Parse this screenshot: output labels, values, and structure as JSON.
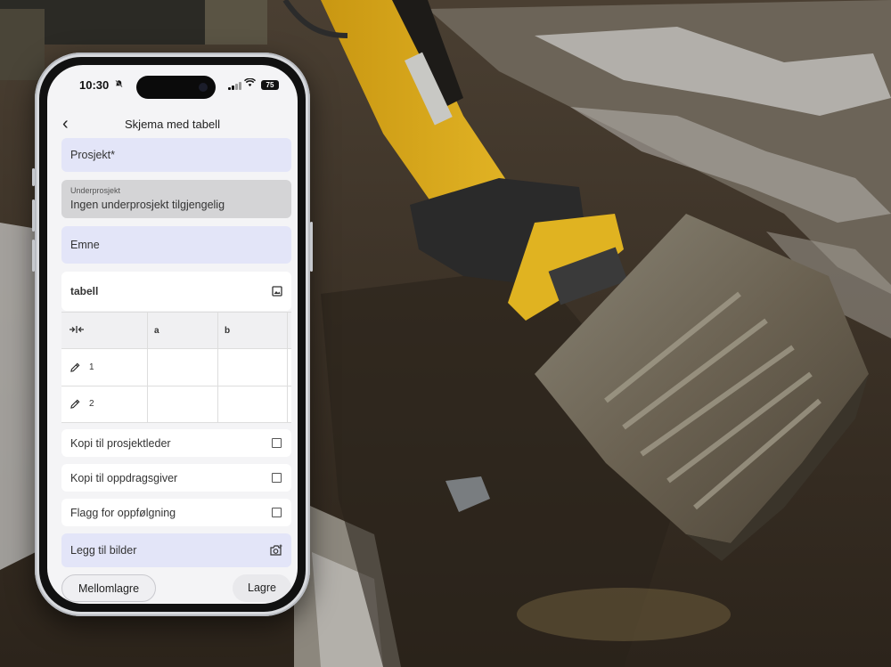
{
  "status_bar": {
    "time": "10:30",
    "battery": "75"
  },
  "nav": {
    "back_glyph": "‹",
    "title": "Skjema med tabell"
  },
  "form": {
    "prosjekt_label": "Prosjekt*",
    "underprosjekt_label": "Underprosjekt",
    "underprosjekt_value": "Ingen underprosjekt tilgjengelig",
    "emne_label": "Emne",
    "table_title": "tabell",
    "table": {
      "columns": [
        "",
        "a",
        "b"
      ],
      "rows": [
        {
          "label": "1"
        },
        {
          "label": "2"
        }
      ]
    },
    "checkboxes": [
      {
        "label": "Kopi til prosjektleder",
        "checked": false
      },
      {
        "label": "Kopi til oppdragsgiver",
        "checked": false
      },
      {
        "label": "Flagg for oppfølgning",
        "checked": false
      }
    ],
    "add_images_label": "Legg til bilder"
  },
  "buttons": {
    "draft_label": "Mellomlagre",
    "save_label": "Lagre"
  },
  "icons": {
    "back": "chevron-left-icon",
    "image": "image-icon",
    "collapse": "collapse-columns-icon",
    "edit": "pencil-icon",
    "camera": "camera-add-icon",
    "mute": "bell-slash-icon",
    "wifi": "wifi-icon"
  },
  "colors": {
    "field_blue": "#e3e5f8",
    "field_gray": "#d4d4d6",
    "screen_bg": "#f4f4f6",
    "excavator_yellow": "#d9a515"
  }
}
